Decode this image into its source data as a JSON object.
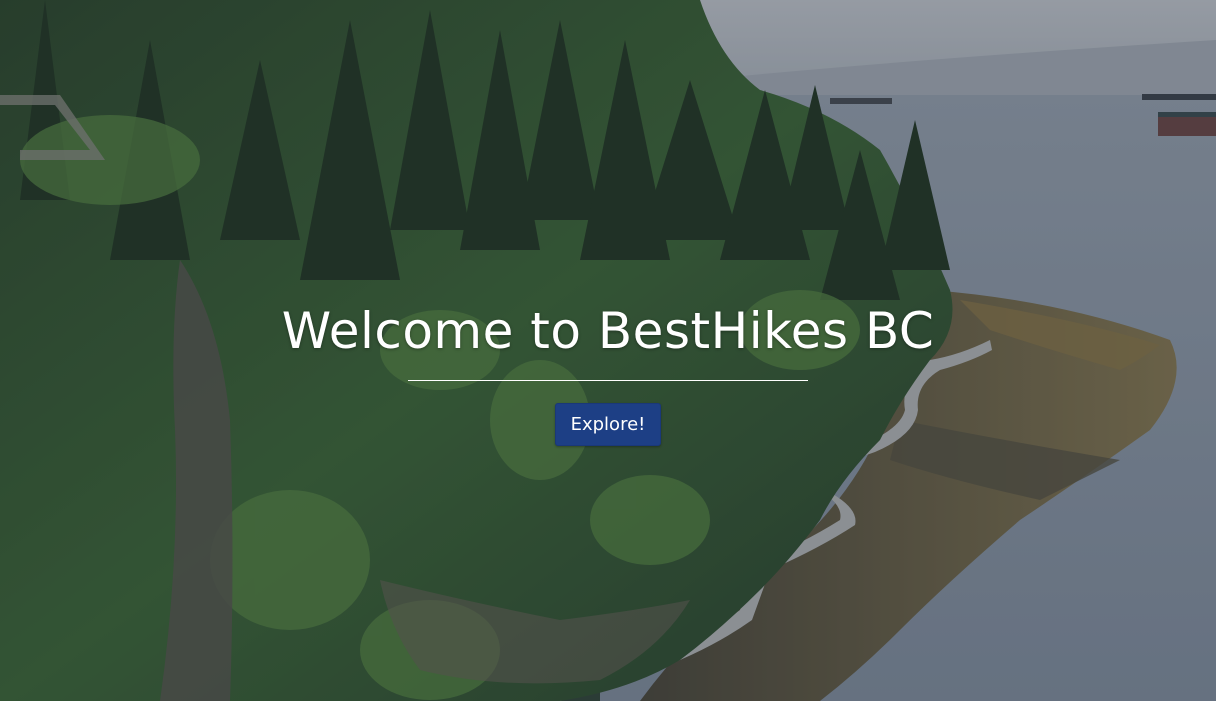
{
  "hero": {
    "title": "Welcome to BestHikes BC",
    "button_label": "Explore!",
    "background_image": "forest cliff seawall and ocean"
  },
  "colors": {
    "button": "#1d3f85",
    "title_text": "#ffffff",
    "divider": "#ffffff"
  }
}
